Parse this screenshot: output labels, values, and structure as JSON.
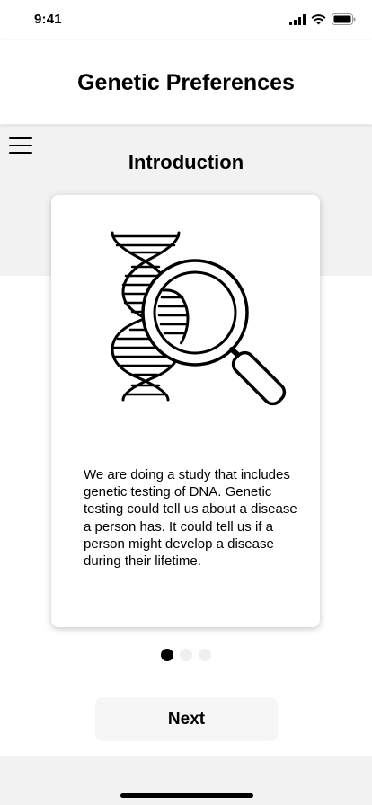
{
  "status_bar": {
    "time": "9:41"
  },
  "header": {
    "title": "Genetic Preferences"
  },
  "section": {
    "title": "Introduction"
  },
  "card": {
    "illustration_icon": "dna-magnifier-icon",
    "body": "We are doing a study that includes genetic testing of DNA. Genetic testing could tell us about a disease a person has. It could tell us if a person might develop a disease during their lifetime."
  },
  "pager": {
    "total": 3,
    "active_index": 0
  },
  "footer": {
    "next_label": "Next"
  }
}
